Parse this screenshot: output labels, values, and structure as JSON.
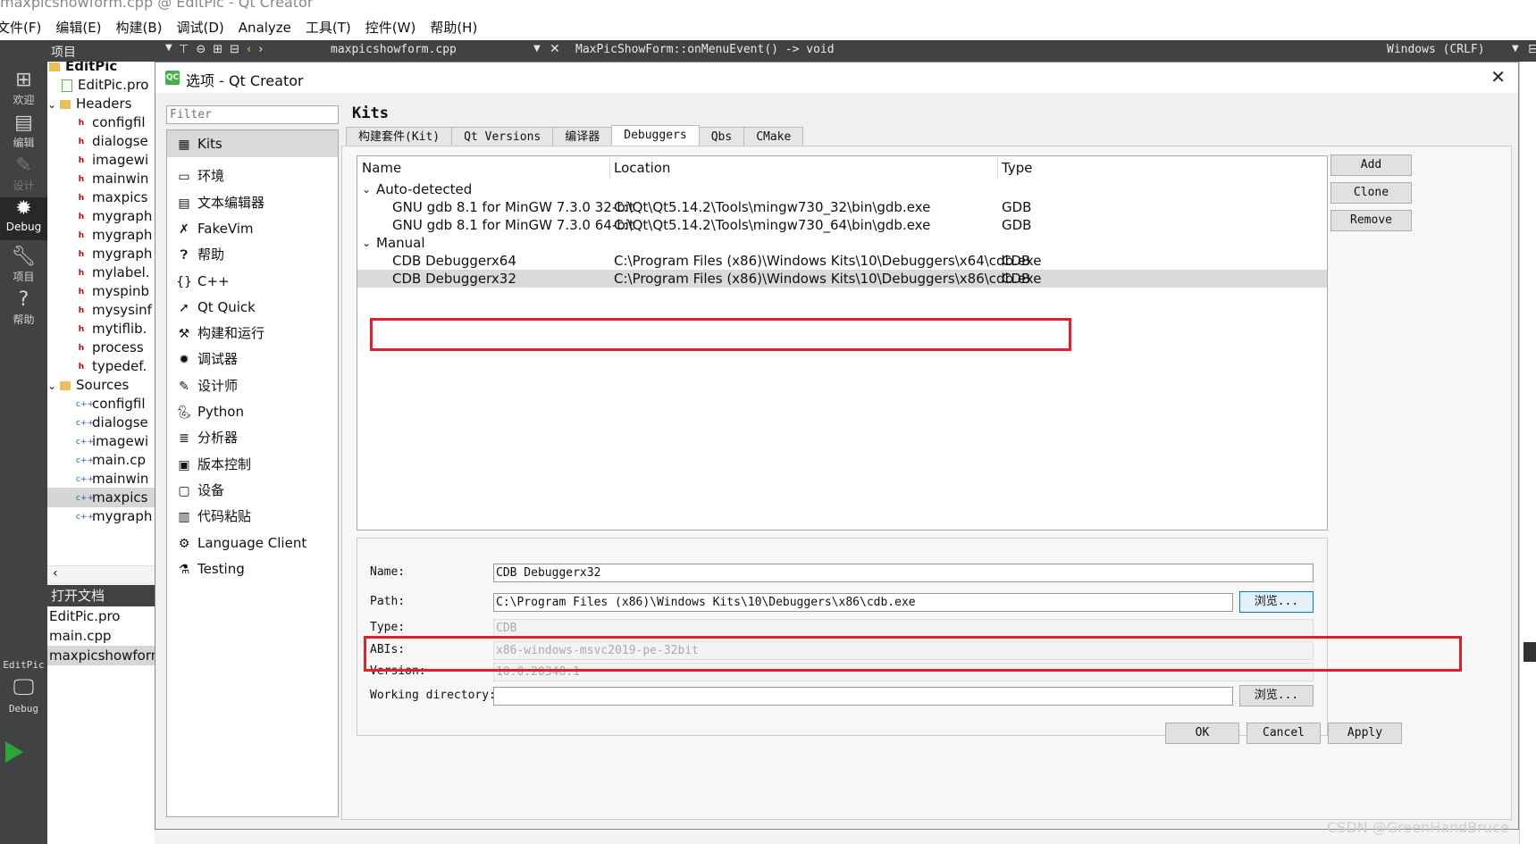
{
  "window": {
    "title": "maxpicshowform.cpp @ EditPic - Qt Creator"
  },
  "menu": [
    "文件(F)",
    "编辑(E)",
    "构建(B)",
    "调试(D)",
    "Analyze",
    "工具(T)",
    "控件(W)",
    "帮助(H)"
  ],
  "toolbar": {
    "project_label": "项目",
    "file": "maxpicshowform.cpp",
    "function": "MaxPicShowForm::onMenuEvent() -> void",
    "encoding": "Windows (CRLF)"
  },
  "modes": [
    {
      "label": "欢迎",
      "icon": "grid-icon"
    },
    {
      "label": "编辑",
      "icon": "edit-icon"
    },
    {
      "label": "设计",
      "icon": "pencil-icon"
    },
    {
      "label": "Debug",
      "icon": "bug-icon"
    },
    {
      "label": "项目",
      "icon": "wrench-icon"
    },
    {
      "label": "帮助",
      "icon": "help-icon"
    }
  ],
  "kit_selector": {
    "project": "EditPic",
    "config": "Debug"
  },
  "project_tree": {
    "root": "EditPic",
    "pro_file": "EditPic.pro",
    "headers_label": "Headers",
    "headers": [
      "configfil",
      "dialogse",
      "imagewi",
      "mainwin",
      "maxpics",
      "mygraph",
      "mygraph",
      "mygraph",
      "mylabel.",
      "myspinb",
      "mysysinf",
      "mytiflib.",
      "process",
      "typedef."
    ],
    "sources_label": "Sources",
    "sources": [
      "configfil",
      "dialogse",
      "imagewi",
      "main.cp",
      "mainwin",
      "maxpics",
      "mygraph"
    ]
  },
  "open_docs": {
    "title": "打开文档",
    "items": [
      "EditPic.pro",
      "main.cpp",
      "maxpicshowform"
    ]
  },
  "dialog": {
    "title": "选项 - Qt Creator",
    "filter_placeholder": "Filter",
    "categories": [
      "Kits",
      "环境",
      "文本编辑器",
      "FakeVim",
      "帮助",
      "C++",
      "Qt Quick",
      "构建和运行",
      "调试器",
      "设计师",
      "Python",
      "分析器",
      "版本控制",
      "设备",
      "代码粘贴",
      "Language Client",
      "Testing"
    ],
    "category_icons": [
      "kits-icon",
      "monitor-icon",
      "text-editor-icon",
      "fakevim-icon",
      "help-icon",
      "braces-icon",
      "qtquick-icon",
      "build-run-icon",
      "bug-icon",
      "pencil-icon",
      "python-icon",
      "analyzer-icon",
      "version-control-icon",
      "device-icon",
      "paste-icon",
      "language-client-icon",
      "testing-icon"
    ],
    "page_title": "Kits",
    "tabs": [
      "构建套件(Kit)",
      "Qt Versions",
      "编译器",
      "Debuggers",
      "Qbs",
      "CMake"
    ],
    "active_tab": "Debuggers",
    "table": {
      "headers": [
        "Name",
        "Location",
        "Type"
      ],
      "groups": [
        {
          "name": "Auto-detected",
          "rows": [
            {
              "name": "GNU gdb 8.1 for MinGW 7.3.0 32-bit",
              "location": "C:\\Qt\\Qt5.14.2\\Tools\\mingw730_32\\bin\\gdb.exe",
              "type": "GDB"
            },
            {
              "name": "GNU gdb 8.1 for MinGW 7.3.0 64-bit",
              "location": "C:\\Qt\\Qt5.14.2\\Tools\\mingw730_64\\bin\\gdb.exe",
              "type": "GDB"
            }
          ]
        },
        {
          "name": "Manual",
          "rows": [
            {
              "name": "CDB Debuggerx64",
              "location": "C:\\Program Files (x86)\\Windows Kits\\10\\Debuggers\\x64\\cdb.exe",
              "type": "CDB"
            },
            {
              "name": "CDB Debuggerx32",
              "location": "C:\\Program Files (x86)\\Windows Kits\\10\\Debuggers\\x86\\cdb.exe",
              "type": "CDB"
            }
          ]
        }
      ]
    },
    "side_buttons": [
      "Add",
      "Clone",
      "Remove"
    ],
    "details": {
      "name_label": "Name:",
      "name_value": "CDB Debuggerx32",
      "path_label": "Path:",
      "path_value": "C:\\Program Files (x86)\\Windows Kits\\10\\Debuggers\\x86\\cdb.exe",
      "type_label": "Type:",
      "type_value": "CDB",
      "abis_label": "ABIs:",
      "abis_value": "x86-windows-msvc2019-pe-32bit",
      "version_label": "Version:",
      "version_value": "10.0.20348.1",
      "workdir_label": "Working directory:",
      "workdir_value": "",
      "browse_label": "浏览..."
    },
    "buttons": {
      "ok": "OK",
      "cancel": "Cancel",
      "apply": "Apply"
    }
  },
  "watermark": "CSDN @GreenHandBruce",
  "colors": {
    "highlight": "#e0202a",
    "sidebar_dark": "#404244",
    "run_green": "#2fa43a"
  }
}
